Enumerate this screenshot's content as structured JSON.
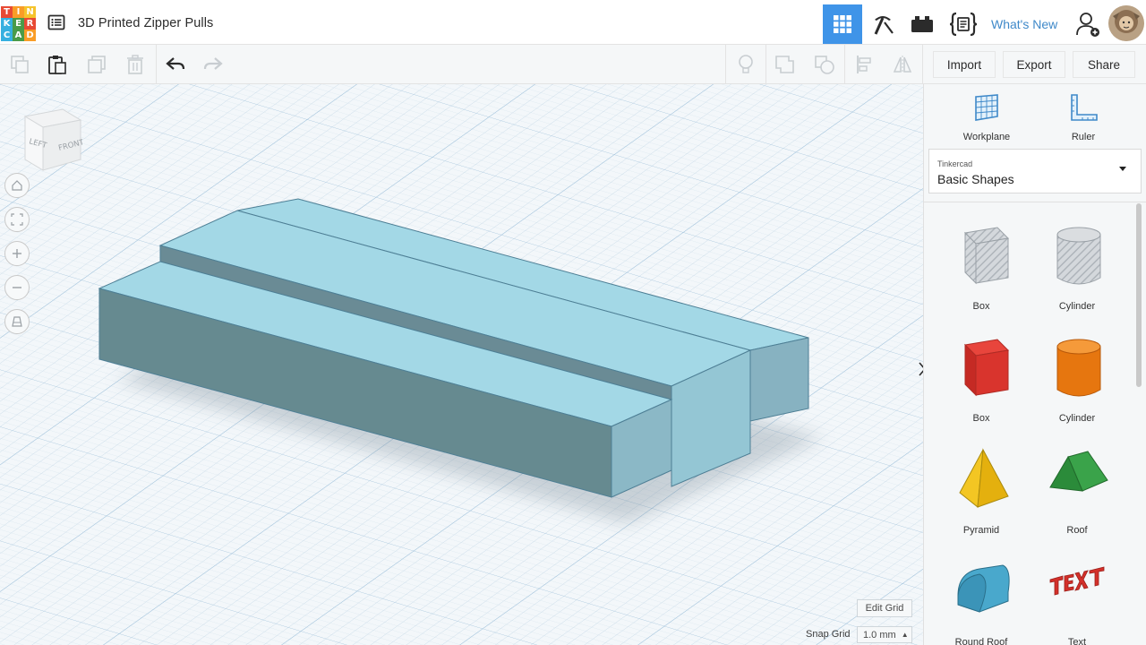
{
  "header": {
    "logo_letters": [
      "T",
      "I",
      "N",
      "K",
      "E",
      "R",
      "C",
      "A",
      "D"
    ],
    "logo_colors": [
      "#e84a34",
      "#f99d27",
      "#f5c42d",
      "#36b0e0",
      "#4a9b49",
      "#e84a34",
      "#36b0e0",
      "#4a9b49",
      "#f99d27"
    ],
    "design_title": "3D Printed Zipper Pulls",
    "whats_new": "What's New",
    "accent": "#3f94e8"
  },
  "toolbar": {
    "import_label": "Import",
    "export_label": "Export",
    "share_label": "Share"
  },
  "canvas": {
    "viewcube_left": "LEFT",
    "viewcube_front": "FRONT",
    "edit_grid_label": "Edit Grid",
    "snap_grid_label": "Snap Grid",
    "snap_grid_value": "1.0 mm",
    "shape_color": "#a3d8e6"
  },
  "panel": {
    "workplane_label": "Workplane",
    "ruler_label": "Ruler",
    "library_category": "Tinkercad",
    "library_selected": "Basic Shapes",
    "shapes": [
      {
        "label": "Box",
        "icon": "box-hole-icon"
      },
      {
        "label": "Cylinder",
        "icon": "cylinder-hole-icon"
      },
      {
        "label": "Box",
        "icon": "box-icon"
      },
      {
        "label": "Cylinder",
        "icon": "cylinder-icon"
      },
      {
        "label": "Pyramid",
        "icon": "pyramid-icon"
      },
      {
        "label": "Roof",
        "icon": "roof-icon"
      },
      {
        "label": "Round Roof",
        "icon": "round-roof-icon"
      },
      {
        "label": "Text",
        "icon": "text-shape-icon"
      }
    ]
  }
}
